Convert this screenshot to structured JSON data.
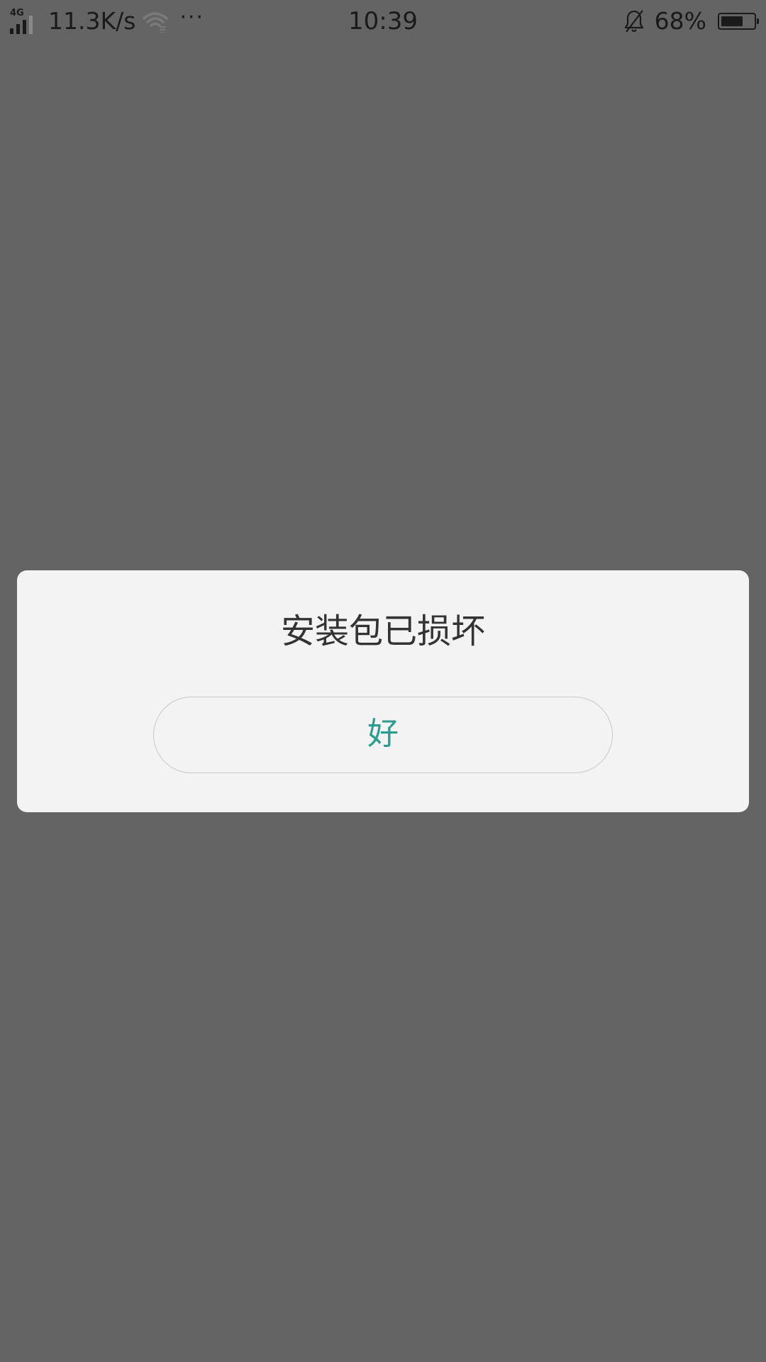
{
  "status_bar": {
    "network_type": "4G",
    "net_speed": "11.3K/s",
    "more_indicator": "···",
    "time": "10:39",
    "battery_percent_text": "68%",
    "battery_level": 0.68,
    "icons": {
      "signal": "signal-strength-icon",
      "wifi": "wifi-icon",
      "notifications": "bell-muted-icon",
      "battery": "battery-icon"
    }
  },
  "dialog": {
    "title": "安装包已损坏",
    "ok_label": "好"
  },
  "colors": {
    "overlay": "#646464",
    "dialog_background": "#f3f3f3",
    "accent": "#2a9d8f",
    "title_text": "#333333"
  }
}
